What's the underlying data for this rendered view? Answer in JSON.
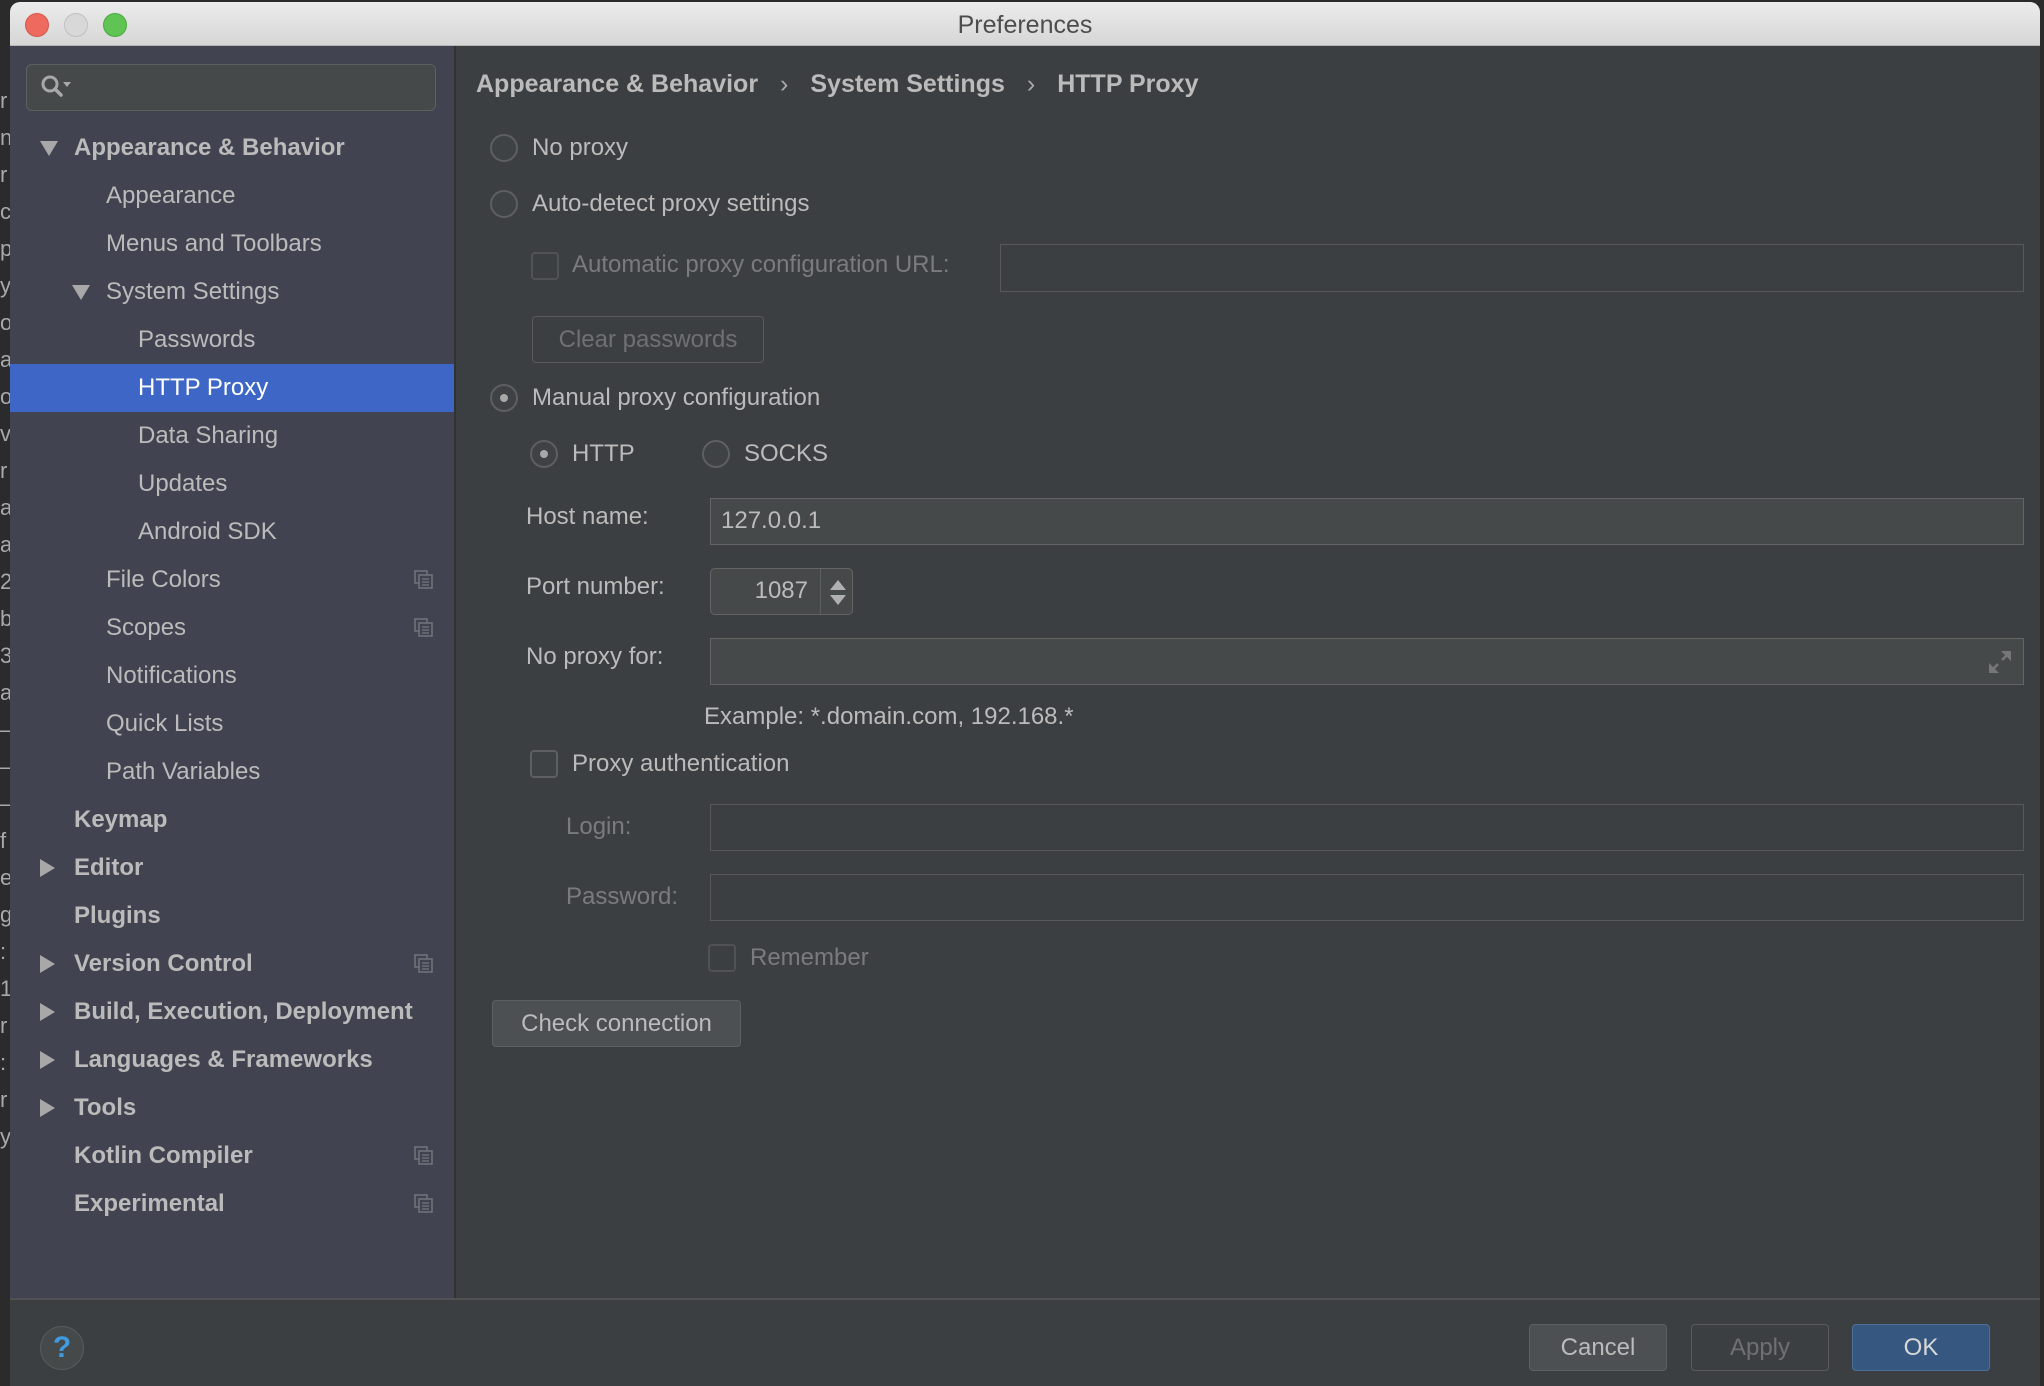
{
  "window": {
    "title": "Preferences",
    "background_fragments": "r\nn\nr\nc\np\ny\no\na\no\nv\nr\na\na\n2\nb\n3.\na\n—\n—\n—\nf\ne\ng\n:\n1\nr\n:\nr\ny"
  },
  "sidebar": {
    "search": {
      "placeholder": "",
      "value": ""
    },
    "items": [
      {
        "label": "Appearance & Behavior",
        "level": 0,
        "bold": true,
        "expander": "expanded",
        "project_icon": false,
        "selected": false
      },
      {
        "label": "Appearance",
        "level": 1,
        "bold": false,
        "expander": "none",
        "project_icon": false,
        "selected": false
      },
      {
        "label": "Menus and Toolbars",
        "level": 1,
        "bold": false,
        "expander": "none",
        "project_icon": false,
        "selected": false
      },
      {
        "label": "System Settings",
        "level": 1,
        "bold": false,
        "expander": "expanded",
        "project_icon": false,
        "selected": false
      },
      {
        "label": "Passwords",
        "level": 2,
        "bold": false,
        "expander": "none",
        "project_icon": false,
        "selected": false
      },
      {
        "label": "HTTP Proxy",
        "level": 2,
        "bold": false,
        "expander": "none",
        "project_icon": false,
        "selected": true
      },
      {
        "label": "Data Sharing",
        "level": 2,
        "bold": false,
        "expander": "none",
        "project_icon": false,
        "selected": false
      },
      {
        "label": "Updates",
        "level": 2,
        "bold": false,
        "expander": "none",
        "project_icon": false,
        "selected": false
      },
      {
        "label": "Android SDK",
        "level": 2,
        "bold": false,
        "expander": "none",
        "project_icon": false,
        "selected": false
      },
      {
        "label": "File Colors",
        "level": 1,
        "bold": false,
        "expander": "none",
        "project_icon": true,
        "selected": false
      },
      {
        "label": "Scopes",
        "level": 1,
        "bold": false,
        "expander": "none",
        "project_icon": true,
        "selected": false
      },
      {
        "label": "Notifications",
        "level": 1,
        "bold": false,
        "expander": "none",
        "project_icon": false,
        "selected": false
      },
      {
        "label": "Quick Lists",
        "level": 1,
        "bold": false,
        "expander": "none",
        "project_icon": false,
        "selected": false
      },
      {
        "label": "Path Variables",
        "level": 1,
        "bold": false,
        "expander": "none",
        "project_icon": false,
        "selected": false
      },
      {
        "label": "Keymap",
        "level": 0,
        "bold": true,
        "expander": "none",
        "project_icon": false,
        "selected": false
      },
      {
        "label": "Editor",
        "level": 0,
        "bold": true,
        "expander": "collapsed",
        "project_icon": false,
        "selected": false
      },
      {
        "label": "Plugins",
        "level": 0,
        "bold": true,
        "expander": "none",
        "project_icon": false,
        "selected": false
      },
      {
        "label": "Version Control",
        "level": 0,
        "bold": true,
        "expander": "collapsed",
        "project_icon": true,
        "selected": false
      },
      {
        "label": "Build, Execution, Deployment",
        "level": 0,
        "bold": true,
        "expander": "collapsed",
        "project_icon": false,
        "selected": false
      },
      {
        "label": "Languages & Frameworks",
        "level": 0,
        "bold": true,
        "expander": "collapsed",
        "project_icon": false,
        "selected": false
      },
      {
        "label": "Tools",
        "level": 0,
        "bold": true,
        "expander": "collapsed",
        "project_icon": false,
        "selected": false
      },
      {
        "label": "Kotlin Compiler",
        "level": 0,
        "bold": true,
        "expander": "none",
        "project_icon": true,
        "selected": false
      },
      {
        "label": "Experimental",
        "level": 0,
        "bold": true,
        "expander": "none",
        "project_icon": true,
        "selected": false
      }
    ]
  },
  "breadcrumb": [
    "Appearance & Behavior",
    "System Settings",
    "HTTP Proxy"
  ],
  "proxy": {
    "no_proxy_label": "No proxy",
    "auto_detect_label": "Auto-detect proxy settings",
    "auto_config_url_label": "Automatic proxy configuration URL:",
    "auto_config_url_value": "",
    "clear_passwords_label": "Clear passwords",
    "manual_label": "Manual proxy configuration",
    "selected_mode": "manual",
    "http_label": "HTTP",
    "socks_label": "SOCKS",
    "selected_type": "HTTP",
    "host_label": "Host name:",
    "host_value": "127.0.0.1",
    "port_label": "Port number:",
    "port_value": "1087",
    "no_proxy_for_label": "No proxy for:",
    "no_proxy_for_value": "",
    "example_text": "Example: *.domain.com, 192.168.*",
    "auth_label": "Proxy authentication",
    "auth_checked": false,
    "login_label": "Login:",
    "login_value": "",
    "password_label": "Password:",
    "password_value": "",
    "remember_label": "Remember",
    "remember_checked": false,
    "check_connection_label": "Check connection"
  },
  "footer": {
    "help_label": "?",
    "cancel_label": "Cancel",
    "apply_label": "Apply",
    "ok_label": "OK"
  },
  "colors": {
    "selection": "#3d66c6",
    "primary_button": "#365880",
    "help_icon": "#3f9ae0"
  }
}
